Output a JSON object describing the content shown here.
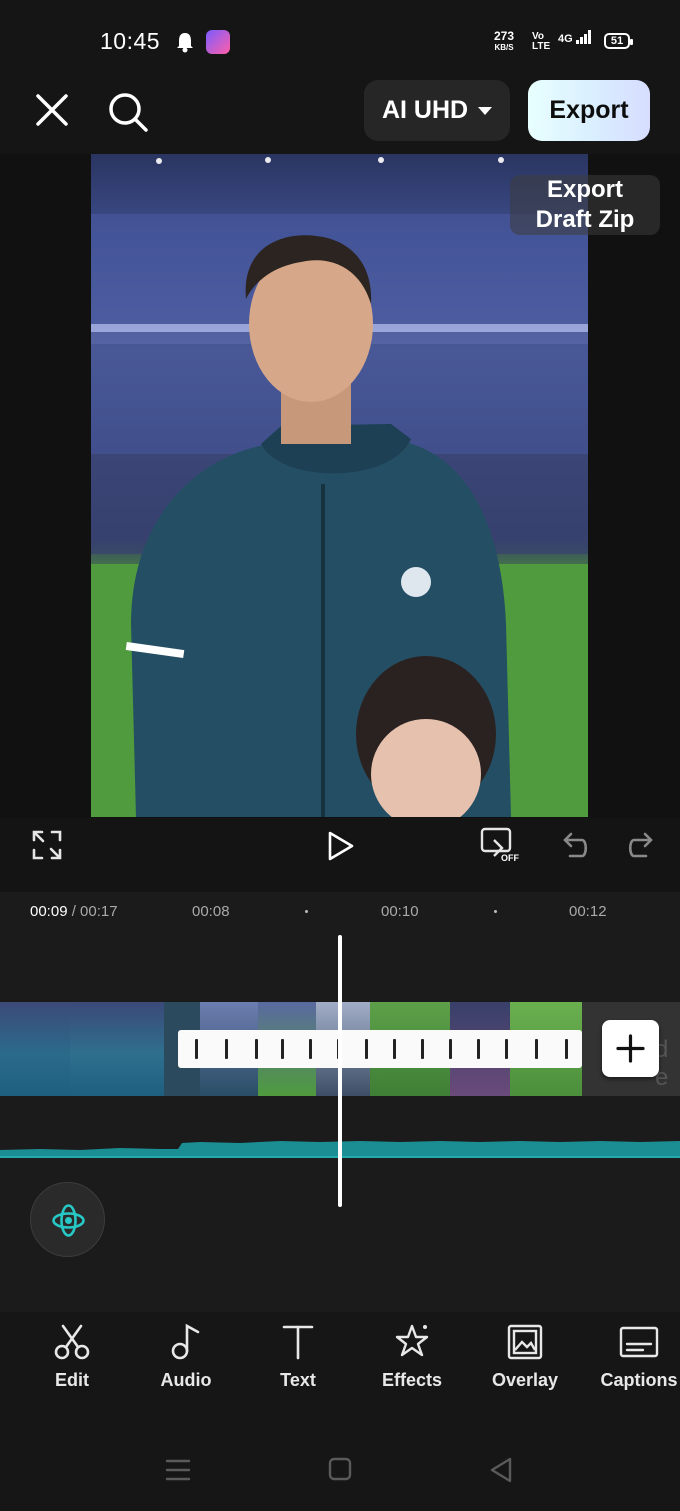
{
  "status_bar": {
    "time": "10:45",
    "net_speed_value": "273",
    "net_speed_unit": "KB/S",
    "volte": "Vo LTE",
    "network": "4G",
    "battery": "51",
    "icons": [
      "bell-icon",
      "app-notification-icon",
      "signal-icon",
      "battery-icon"
    ]
  },
  "top_bar": {
    "ai_uhd_label": "AI UHD",
    "export_label": "Export",
    "icons": [
      "close-icon",
      "search-icon",
      "caret-down-icon"
    ]
  },
  "preview": {
    "export_draft_zip_line1": "Export",
    "export_draft_zip_line2": "Draft Zip"
  },
  "controls": {
    "keyframe_state": "OFF",
    "icons": [
      "fullscreen-icon",
      "play-icon",
      "keyframe-off-icon",
      "undo-icon",
      "redo-icon"
    ]
  },
  "timeline": {
    "current_time": "00:09",
    "total_time": "/ 00:17",
    "markers": [
      "00:08",
      "00:10",
      "00:12"
    ],
    "tail_text": "d e",
    "icons": [
      "add-icon",
      "ai-motion-icon"
    ]
  },
  "toolbar": {
    "items": [
      {
        "label": "Edit",
        "icon": "scissors-icon"
      },
      {
        "label": "Audio",
        "icon": "music-note-icon"
      },
      {
        "label": "Text",
        "icon": "text-icon"
      },
      {
        "label": "Effects",
        "icon": "effects-star-icon"
      },
      {
        "label": "Overlay",
        "icon": "overlay-icon"
      },
      {
        "label": "Captions",
        "icon": "captions-icon"
      }
    ]
  },
  "nav": {
    "icons": [
      "menu-nav-icon",
      "home-nav-icon",
      "back-nav-icon"
    ]
  },
  "colors": {
    "background": "#151515",
    "accent_teal": "#1fb5b8",
    "export_gradient_start": "#e8ffff",
    "export_gradient_end": "#d7ddff"
  }
}
